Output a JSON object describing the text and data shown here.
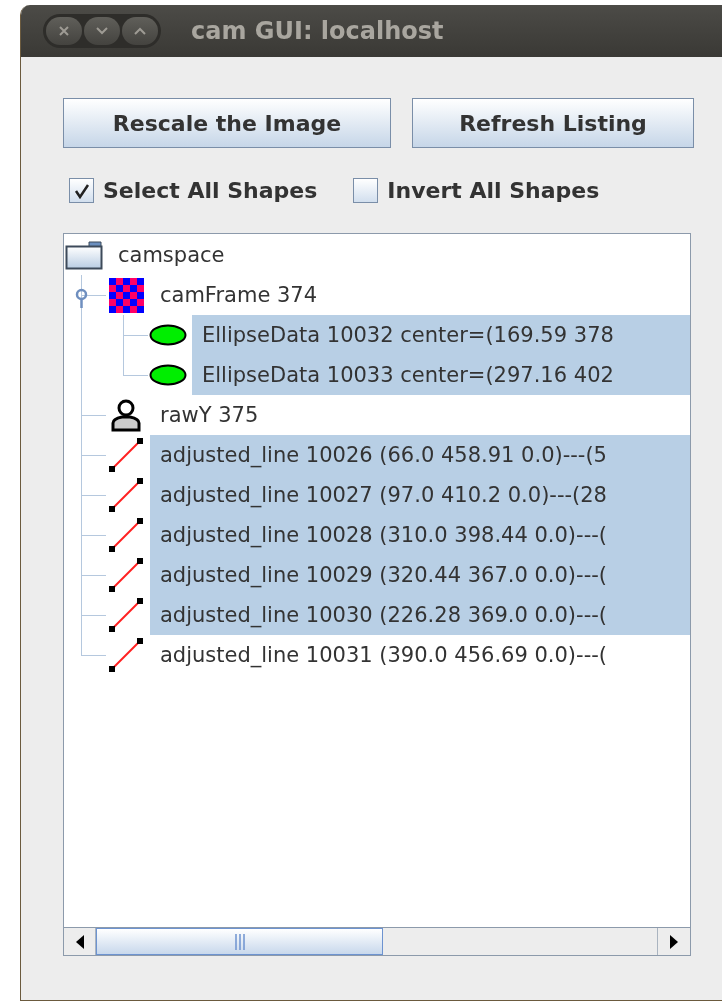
{
  "window": {
    "title": "cam GUI: localhost"
  },
  "buttons": [
    "Rescale the Image",
    "Refresh Listing"
  ],
  "checkboxes": [
    {
      "label": "Select All Shapes",
      "checked": true
    },
    {
      "label": "Invert All Shapes",
      "checked": false
    }
  ],
  "tree": {
    "label": "camspace",
    "kind": "folder",
    "selected": false,
    "children": [
      {
        "label": "camFrame 374",
        "kind": "frame",
        "selected": false,
        "expanded": true,
        "children": [
          {
            "label": "EllipseData 10032 center=(169.59 378",
            "kind": "ellipse",
            "selected": true
          },
          {
            "label": "EllipseData 10033 center=(297.16 402",
            "kind": "ellipse",
            "selected": true
          }
        ]
      },
      {
        "label": "rawY 375",
        "kind": "person",
        "selected": false
      },
      {
        "label": "adjusted_line 10026 (66.0 458.91 0.0)---(5",
        "kind": "line",
        "selected": true
      },
      {
        "label": "adjusted_line 10027 (97.0 410.2 0.0)---(28",
        "kind": "line",
        "selected": true
      },
      {
        "label": "adjusted_line 10028 (310.0 398.44 0.0)---(",
        "kind": "line",
        "selected": true
      },
      {
        "label": "adjusted_line 10029 (320.44 367.0 0.0)---(",
        "kind": "line",
        "selected": true
      },
      {
        "label": "adjusted_line 10030 (226.28 369.0 0.0)---(",
        "kind": "line",
        "selected": true
      },
      {
        "label": "adjusted_line 10031 (390.0 456.69 0.0)---(",
        "kind": "line",
        "selected": false
      }
    ]
  }
}
